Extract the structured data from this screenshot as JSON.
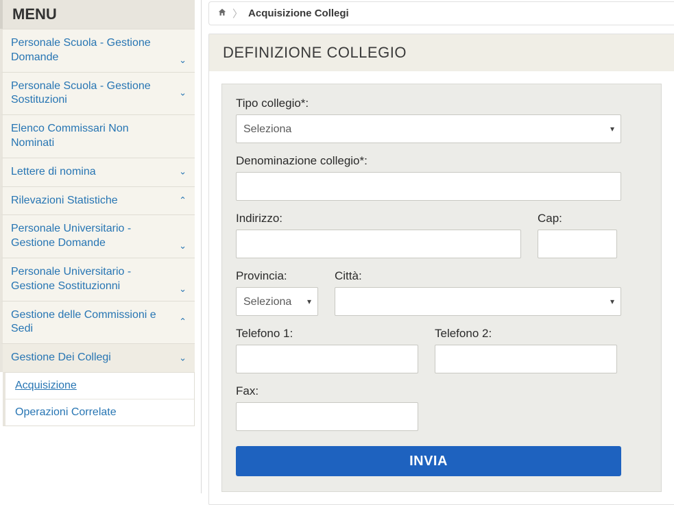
{
  "sidebar": {
    "title": "MENU",
    "items": [
      {
        "label": "Personale Scuola - Gestione Domande",
        "chevron": "down",
        "chevron_pos": "bottom"
      },
      {
        "label": "Personale Scuola - Gestione Sostituzioni",
        "chevron": "down",
        "chevron_pos": "mid"
      },
      {
        "label": "Elenco Commissari Non Nominati",
        "chevron": null
      },
      {
        "label": "Lettere di nomina",
        "chevron": "down",
        "chevron_pos": "mid"
      },
      {
        "label": "Rilevazioni Statistiche",
        "chevron": "up",
        "chevron_pos": "mid"
      },
      {
        "label": "Personale Universitario - Gestione Domande",
        "chevron": "down",
        "chevron_pos": "bottom"
      },
      {
        "label": "Personale Universitario - Gestione Sostituzionni",
        "chevron": "down",
        "chevron_pos": "bottom"
      },
      {
        "label": "Gestione delle Commissioni e Sedi",
        "chevron": "up",
        "chevron_pos": "mid"
      },
      {
        "label": "Gestione Dei Collegi",
        "chevron": "down",
        "chevron_pos": "mid",
        "expanded": true,
        "sub": [
          {
            "label": "Acquisizione",
            "active": true
          },
          {
            "label": "Operazioni Correlate",
            "active": false
          }
        ]
      }
    ]
  },
  "breadcrumb": {
    "current": "Acquisizione Collegi"
  },
  "panel": {
    "title": "DEFINIZIONE COLLEGIO"
  },
  "form": {
    "tipo_collegio": {
      "label": "Tipo collegio*:",
      "selected": "Seleziona"
    },
    "denominazione": {
      "label": "Denominazione collegio*:",
      "value": ""
    },
    "indirizzo": {
      "label": "Indirizzo:",
      "value": ""
    },
    "cap": {
      "label": "Cap:",
      "value": ""
    },
    "provincia": {
      "label": "Provincia:",
      "selected": "Seleziona"
    },
    "citta": {
      "label": "Città:",
      "selected": ""
    },
    "tel1": {
      "label": "Telefono 1:",
      "value": ""
    },
    "tel2": {
      "label": "Telefono 2:",
      "value": ""
    },
    "fax": {
      "label": "Fax:",
      "value": ""
    },
    "submit": "INVIA"
  }
}
